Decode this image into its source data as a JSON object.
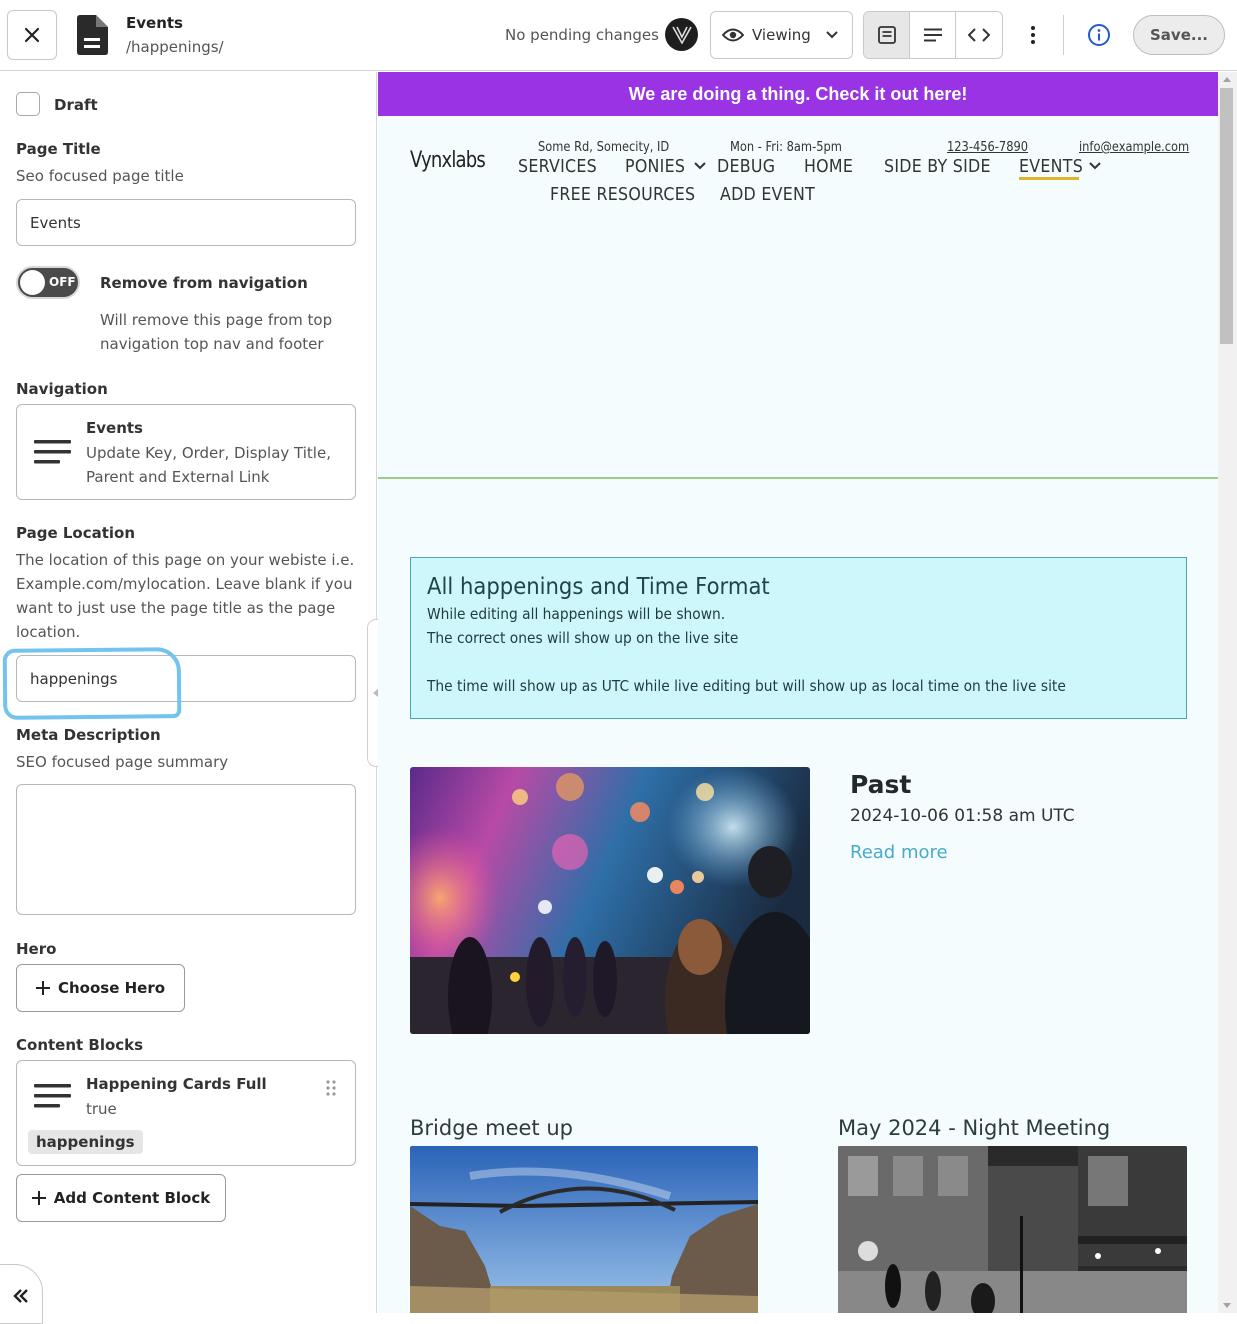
{
  "header": {
    "close_icon": "close-icon",
    "file_icon": "file-document-icon",
    "title": "Events",
    "path": "/happenings/",
    "pending_status": "No pending changes",
    "mode_label": "Viewing",
    "view_modes": [
      "layout-icon",
      "list-icon",
      "code-icon"
    ],
    "save_label": "Save..."
  },
  "sidebar": {
    "draft_label": "Draft",
    "page_title": {
      "label": "Page Title",
      "help": "Seo focused page title",
      "value": "Events"
    },
    "remove_nav": {
      "toggle_text": "OFF",
      "label": "Remove from navigation",
      "help_line1": "Will remove this page from top",
      "help_line2": "navigation top nav and footer"
    },
    "navigation": {
      "label": "Navigation",
      "title": "Events",
      "sub_line1": "Update Key, Order, Display Title,",
      "sub_line2": "Parent and External Link"
    },
    "page_location": {
      "label": "Page Location",
      "help_line1": "The location of this page on your webiste i.e.",
      "help_line2": "Example.com/mylocation. Leave blank if you",
      "help_line3": "want to just use the page title as the page",
      "help_line4": "location.",
      "value": "happenings"
    },
    "meta": {
      "label": "Meta Description",
      "help": "SEO focused page summary",
      "value": ""
    },
    "hero": {
      "label": "Hero",
      "button": "Choose Hero"
    },
    "content_blocks": {
      "label": "Content Blocks",
      "block_title": "Happening Cards Full",
      "block_value": "true",
      "block_tag": "happenings",
      "add_button": "Add Content Block"
    }
  },
  "preview": {
    "banner": "We are doing a thing. Check it out here!",
    "brand": "Vynxlabs",
    "address": "Some Rd, Somecity, ID",
    "hours": "Mon - Fri: 8am-5pm",
    "phone": "123-456-7890",
    "email": "info@example.com",
    "nav": [
      "SERVICES",
      "PONIES",
      "DEBUG",
      "HOME",
      "SIDE BY SIDE",
      "EVENTS",
      "FREE RESOURCES",
      "ADD EVENT"
    ],
    "notice": {
      "title": "All happenings and Time Format",
      "line1": "While editing all happenings will be shown.",
      "line2": "The correct ones will show up on the live site",
      "line3": "The time will show up as UTC while live editing but will show up as local time on the live site"
    },
    "event": {
      "title": "Past",
      "date": "2024-10-06 01:58 am UTC",
      "link": "Read more"
    },
    "cards": [
      "Bridge meet up",
      "May 2024 - Night Meeting"
    ]
  },
  "colors": {
    "banner": "#9a33e3",
    "notice_bg": "#cef7fb",
    "link": "#4aa9c8",
    "active_underline": "#e0b532",
    "highlight_mark": "#73c3ee"
  }
}
